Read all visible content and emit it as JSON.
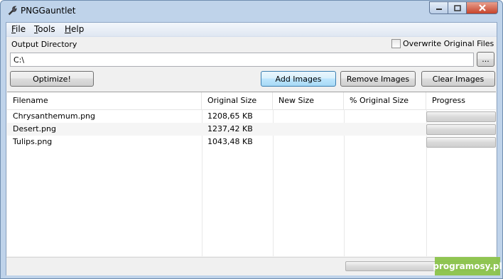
{
  "window": {
    "title": "PNGGauntlet"
  },
  "menu": {
    "items": [
      "File",
      "Tools",
      "Help"
    ]
  },
  "output": {
    "label": "Output Directory",
    "value": "C:\\",
    "browse_label": "...",
    "overwrite_label": "Overwrite Original Files",
    "overwrite_checked": false
  },
  "buttons": {
    "optimize": "Optimize!",
    "add_images": "Add Images",
    "remove_images": "Remove Images",
    "clear_images": "Clear Images"
  },
  "table": {
    "columns": [
      "Filename",
      "Original Size",
      "New Size",
      "% Original Size",
      "Progress"
    ],
    "rows": [
      {
        "filename": "Chrysanthemum.png",
        "original_size": "1208,65 KB",
        "new_size": "",
        "percent": "",
        "progress": 0
      },
      {
        "filename": "Desert.png",
        "original_size": "1237,42 KB",
        "new_size": "",
        "percent": "",
        "progress": 0
      },
      {
        "filename": "Tulips.png",
        "original_size": "1043,48 KB",
        "new_size": "",
        "percent": "",
        "progress": 0
      }
    ]
  },
  "status": {
    "overall_progress": 0
  },
  "watermark": "programosy.pl"
}
